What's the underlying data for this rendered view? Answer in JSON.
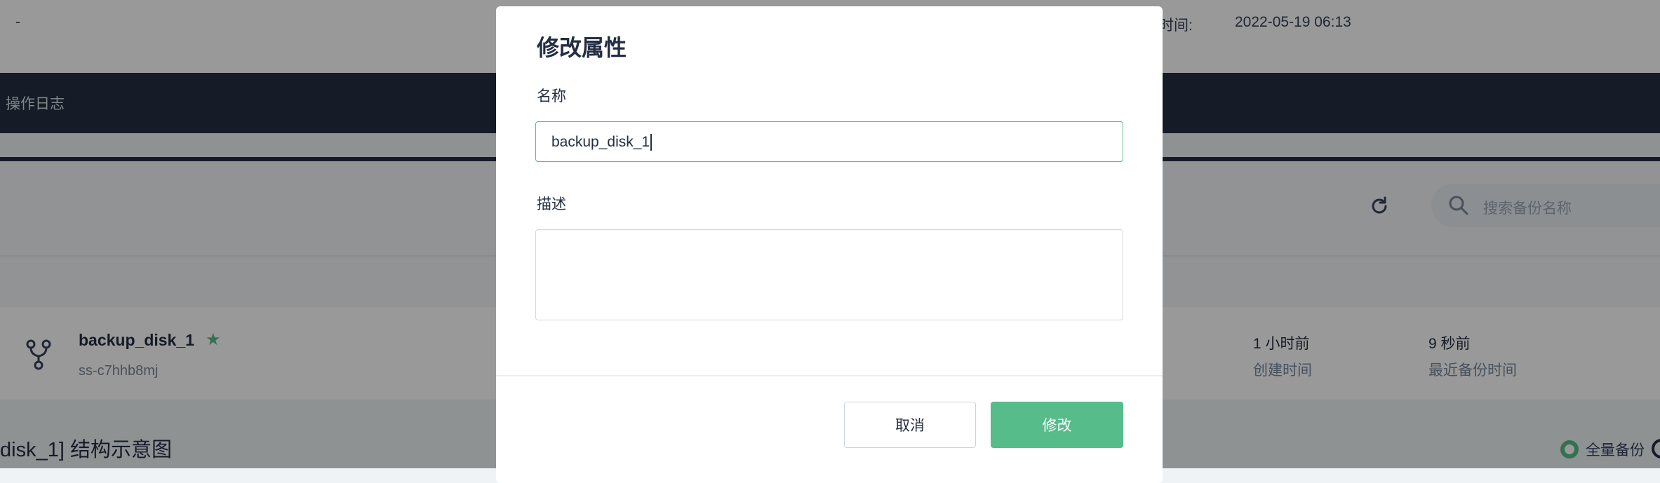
{
  "header": {
    "dash": "-",
    "time_label": "时间:",
    "time_value": "2022-05-19 06:13"
  },
  "nav": {
    "tab_label": "操作日志"
  },
  "toolbar": {
    "search_placeholder": "搜索备份名称"
  },
  "row": {
    "name": "backup_disk_1",
    "star": "★",
    "id": "ss-c7hhb8mj",
    "created_value": "1 小时前",
    "created_label": "创建时间",
    "last_backup_value": "9 秒前",
    "last_backup_label": "最近备份时间"
  },
  "section": {
    "title": "disk_1] 结构示意图"
  },
  "legend": {
    "full_backup": "全量备份"
  },
  "modal": {
    "title": "修改属性",
    "name_label": "名称",
    "name_value": "backup_disk_1",
    "desc_label": "描述",
    "desc_value": "",
    "cancel": "取消",
    "submit": "修改"
  },
  "colors": {
    "accent": "#55bc8a",
    "nav_dark": "#242e42",
    "overlay": "rgba(0,0,0,0.4)"
  },
  "icons": [
    "refresh-icon",
    "search-icon",
    "fork-icon",
    "star-icon",
    "legend-dot-icon"
  ]
}
